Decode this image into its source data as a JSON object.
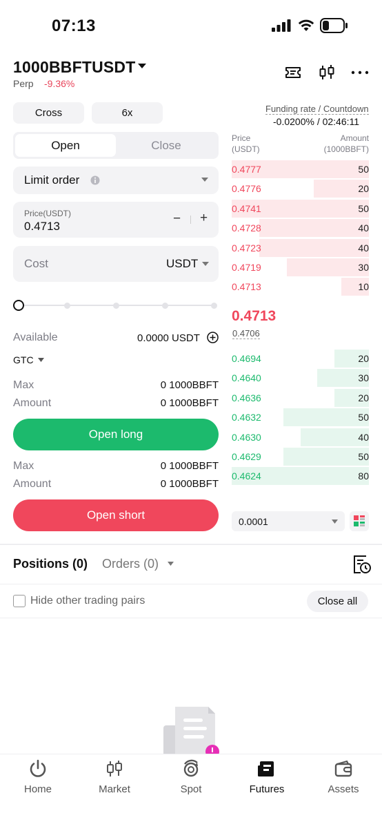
{
  "status_bar": {
    "time": "07:13"
  },
  "header": {
    "pair": "1000BBFTUSDT",
    "type": "Perp",
    "change": "-9.36%"
  },
  "controls": {
    "margin_mode": "Cross",
    "leverage": "6x"
  },
  "funding": {
    "label": "Funding rate / Countdown",
    "value": "-0.0200% / 02:46:11"
  },
  "tabs": {
    "open": "Open",
    "close": "Close"
  },
  "order_type": "Limit order",
  "price_field": {
    "label": "Price(USDT)",
    "value": "0.4713",
    "minus": "−",
    "plus": "+"
  },
  "cost_field": {
    "placeholder": "Cost",
    "unit": "USDT"
  },
  "slider": {
    "level": 0
  },
  "available": {
    "label": "Available",
    "value": "0.0000 USDT"
  },
  "tif": "GTC",
  "long": {
    "max_label": "Max",
    "amount_label": "Amount",
    "max_value": "0 1000BBFT",
    "amount_value": "0 1000BBFT",
    "button": "Open long"
  },
  "short": {
    "max_label": "Max",
    "amount_label": "Amount",
    "max_value": "0 1000BBFT",
    "amount_value": "0 1000BBFT",
    "button": "Open short"
  },
  "orderbook": {
    "price_header": "Price",
    "price_unit": "(USDT)",
    "amount_header": "Amount",
    "amount_unit": "(1000BBFT)",
    "asks": [
      {
        "price": "0.4777",
        "amount": "50",
        "depth": 1.0
      },
      {
        "price": "0.4776",
        "amount": "20",
        "depth": 0.4
      },
      {
        "price": "0.4741",
        "amount": "50",
        "depth": 1.0
      },
      {
        "price": "0.4728",
        "amount": "40",
        "depth": 0.8
      },
      {
        "price": "0.4723",
        "amount": "40",
        "depth": 0.8
      },
      {
        "price": "0.4719",
        "amount": "30",
        "depth": 0.6
      },
      {
        "price": "0.4713",
        "amount": "10",
        "depth": 0.2
      }
    ],
    "last_price": "0.4713",
    "mark_price": "0.4706",
    "bids": [
      {
        "price": "0.4694",
        "amount": "20",
        "depth": 0.25
      },
      {
        "price": "0.4640",
        "amount": "30",
        "depth": 0.375
      },
      {
        "price": "0.4636",
        "amount": "20",
        "depth": 0.25
      },
      {
        "price": "0.4632",
        "amount": "50",
        "depth": 0.625
      },
      {
        "price": "0.4630",
        "amount": "40",
        "depth": 0.5
      },
      {
        "price": "0.4629",
        "amount": "50",
        "depth": 0.625
      },
      {
        "price": "0.4624",
        "amount": "80",
        "depth": 1.0
      }
    ],
    "precision": "0.0001"
  },
  "positions": {
    "positions_tab": "Positions (0)",
    "orders_tab": "Orders (0)",
    "hide_pairs": "Hide other trading pairs",
    "close_all": "Close all"
  },
  "nav": [
    {
      "label": "Home",
      "icon": "power-icon"
    },
    {
      "label": "Market",
      "icon": "candles-icon"
    },
    {
      "label": "Spot",
      "icon": "spot-icon"
    },
    {
      "label": "Futures",
      "icon": "futures-icon"
    },
    {
      "label": "Assets",
      "icon": "wallet-icon"
    }
  ],
  "colors": {
    "green": "#1cba6d",
    "red": "#f0475c",
    "ask_bg": "#fde8ea",
    "bid_bg": "#e6f6ee"
  }
}
